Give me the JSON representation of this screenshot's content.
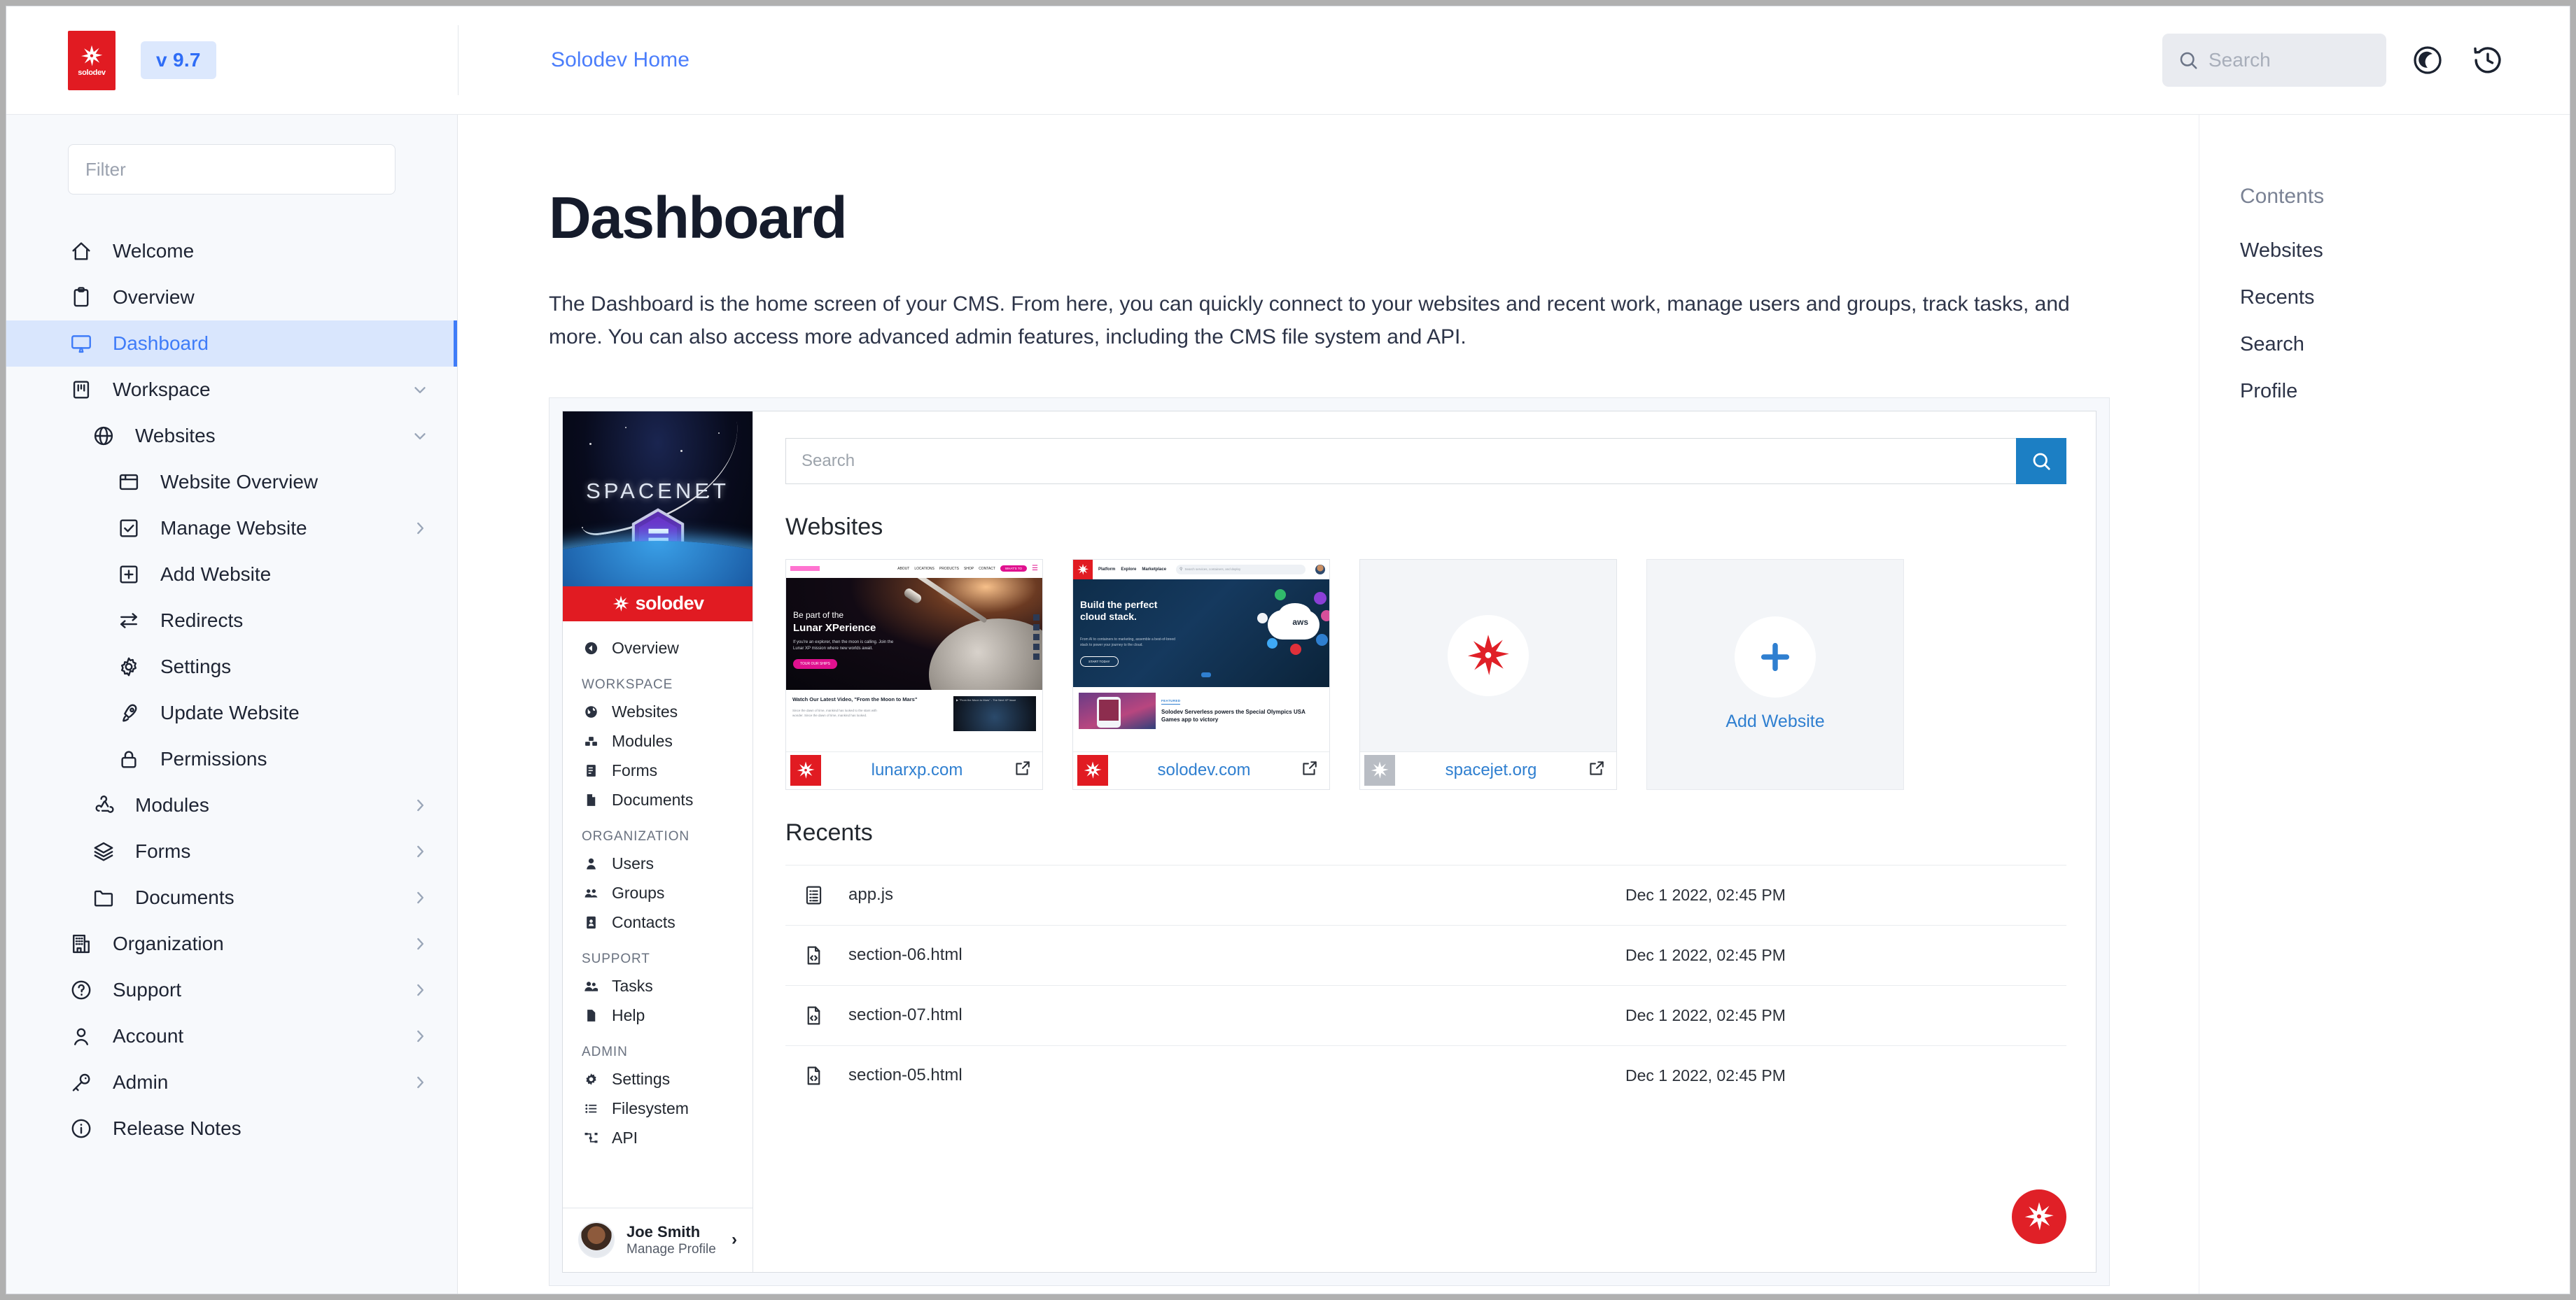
{
  "topbar": {
    "logo_alt": "solodev",
    "logo_wordmark": "solodev",
    "version": "v 9.7",
    "breadcrumb": "Solodev Home",
    "search_placeholder": "Search",
    "dark_mode_icon": "moon-icon",
    "history_icon": "history-icon",
    "brand_red": "#e11b22",
    "accent_blue": "#3f7cf8"
  },
  "sidebar": {
    "filter_placeholder": "Filter",
    "items": [
      {
        "label": "Welcome",
        "icon": "home-icon",
        "level": 0,
        "chevron": "none",
        "active": false
      },
      {
        "label": "Overview",
        "icon": "clipboard-icon",
        "level": 0,
        "chevron": "none",
        "active": false
      },
      {
        "label": "Dashboard",
        "icon": "monitor-icon",
        "level": 0,
        "chevron": "none",
        "active": true
      },
      {
        "label": "Workspace",
        "icon": "kanban-icon",
        "level": 0,
        "chevron": "down",
        "active": false
      },
      {
        "label": "Websites",
        "icon": "globe-icon",
        "level": 1,
        "chevron": "down",
        "active": false
      },
      {
        "label": "Website Overview",
        "icon": "window-icon",
        "level": 2,
        "chevron": "none",
        "active": false
      },
      {
        "label": "Manage Website",
        "icon": "checkbox-icon",
        "level": 2,
        "chevron": "right",
        "active": false
      },
      {
        "label": "Add Website",
        "icon": "plus-square-icon",
        "level": 2,
        "chevron": "none",
        "active": false
      },
      {
        "label": "Redirects",
        "icon": "swap-icon",
        "level": 2,
        "chevron": "none",
        "active": false
      },
      {
        "label": "Settings",
        "icon": "gear-icon",
        "level": 2,
        "chevron": "none",
        "active": false
      },
      {
        "label": "Update Website",
        "icon": "rocket-icon",
        "level": 2,
        "chevron": "none",
        "active": false
      },
      {
        "label": "Permissions",
        "icon": "lock-icon",
        "level": 2,
        "chevron": "none",
        "active": false
      },
      {
        "label": "Modules",
        "icon": "modules-icon",
        "level": 1,
        "chevron": "right",
        "active": false
      },
      {
        "label": "Forms",
        "icon": "layers-icon",
        "level": 1,
        "chevron": "right",
        "active": false
      },
      {
        "label": "Documents",
        "icon": "folder-icon",
        "level": 1,
        "chevron": "right",
        "active": false
      },
      {
        "label": "Organization",
        "icon": "building-icon",
        "level": 0,
        "chevron": "right",
        "active": false
      },
      {
        "label": "Support",
        "icon": "question-icon",
        "level": 0,
        "chevron": "right",
        "active": false
      },
      {
        "label": "Account",
        "icon": "user-icon",
        "level": 0,
        "chevron": "right",
        "active": false
      },
      {
        "label": "Admin",
        "icon": "key-icon",
        "level": 0,
        "chevron": "right",
        "active": false
      },
      {
        "label": "Release Notes",
        "icon": "info-icon",
        "level": 0,
        "chevron": "none",
        "active": false
      }
    ]
  },
  "main": {
    "title": "Dashboard",
    "description": "The Dashboard is the home screen of your CMS. From here, you can quickly connect to your websites and recent work, manage users and groups, track tasks, and more. You can also access more advanced admin features, including the CMS file system and API."
  },
  "embedded_app": {
    "banner_title": "SPACENET",
    "banner_logo": "hexagon-e-icon",
    "brand_bar_text": "solodev",
    "back_item": {
      "label": "Overview",
      "icon": "back-circle-icon"
    },
    "sections": [
      {
        "heading": "WORKSPACE",
        "items": [
          {
            "label": "Websites",
            "icon": "globe-filled-icon"
          },
          {
            "label": "Modules",
            "icon": "modules-filled-icon"
          },
          {
            "label": "Forms",
            "icon": "form-filled-icon"
          },
          {
            "label": "Documents",
            "icon": "document-filled-icon"
          }
        ]
      },
      {
        "heading": "ORGANIZATION",
        "items": [
          {
            "label": "Users",
            "icon": "user-filled-icon"
          },
          {
            "label": "Groups",
            "icon": "group-filled-icon"
          },
          {
            "label": "Contacts",
            "icon": "contact-card-icon"
          }
        ]
      },
      {
        "heading": "SUPPORT",
        "items": [
          {
            "label": "Tasks",
            "icon": "users-filled-icon"
          },
          {
            "label": "Help",
            "icon": "page-filled-icon"
          }
        ]
      },
      {
        "heading": "ADMIN",
        "items": [
          {
            "label": "Settings",
            "icon": "gear-filled-icon"
          },
          {
            "label": "Filesystem",
            "icon": "list-icon"
          },
          {
            "label": "API",
            "icon": "sitemap-icon"
          }
        ]
      }
    ],
    "profile": {
      "name": "Joe Smith",
      "subtitle": "Manage Profile",
      "chevron": "›"
    },
    "search_placeholder": "Search",
    "search_button_icon": "search-icon",
    "websites_heading": "Websites",
    "websites": [
      {
        "domain": "lunarxp.com",
        "logo_style": "red",
        "hero_line1": "Be part of the",
        "hero_line2": "Lunar XPerience",
        "hero_sub": "If you're an explorer, then the moon is calling. Join the Lunar XP mission where new worlds await.",
        "hero_cta": "TOUR OUR SHIPS",
        "nav": [
          "ABOUT",
          "LOCATIONS",
          "PRODUCTS",
          "SHOP",
          "CONTACT"
        ],
        "nav_cta": "WHAT'S TO",
        "below_title": "Watch Our Latest Video, \"From the Moon to Mars\"",
        "external_icon": "external-link-icon"
      },
      {
        "domain": "solodev.com",
        "logo_style": "red",
        "hero_line1": "Build the perfect",
        "hero_line2": "cloud stack.",
        "hero_sub": "From AI to containers to marketing, assemble a best-of-breed stack to power your journey to the cloud.",
        "hero_cta": "START TODAY",
        "nav": [
          "Platform",
          "Explore",
          "Marketplace"
        ],
        "nav_search": "Search services, containers, and deploy",
        "cloud_label": "aws",
        "feature_tag": "FEATURED",
        "feature_title": "Solodev Serverless powers the Special Olympics USA Games app to victory",
        "external_icon": "external-link-icon"
      },
      {
        "domain": "spacejet.org",
        "logo_style": "gray",
        "placeholder_icon": "solodev-starburst-icon",
        "external_icon": "external-link-icon"
      }
    ],
    "add_website": {
      "label": "Add Website",
      "icon": "plus-icon"
    },
    "recents_heading": "Recents",
    "recents": [
      {
        "name": "app.js",
        "icon": "js-file-icon",
        "date": "Dec 1 2022, 02:45 PM"
      },
      {
        "name": "section-06.html",
        "icon": "html-file-icon",
        "date": "Dec 1 2022, 02:45 PM"
      },
      {
        "name": "section-07.html",
        "icon": "html-file-icon",
        "date": "Dec 1 2022, 02:45 PM"
      },
      {
        "name": "section-05.html",
        "icon": "html-file-icon",
        "date": "Dec 1 2022, 02:45 PM"
      }
    ],
    "fab_icon": "solodev-starburst-icon"
  },
  "contents": {
    "title": "Contents",
    "links": [
      "Websites",
      "Recents",
      "Search",
      "Profile"
    ]
  }
}
